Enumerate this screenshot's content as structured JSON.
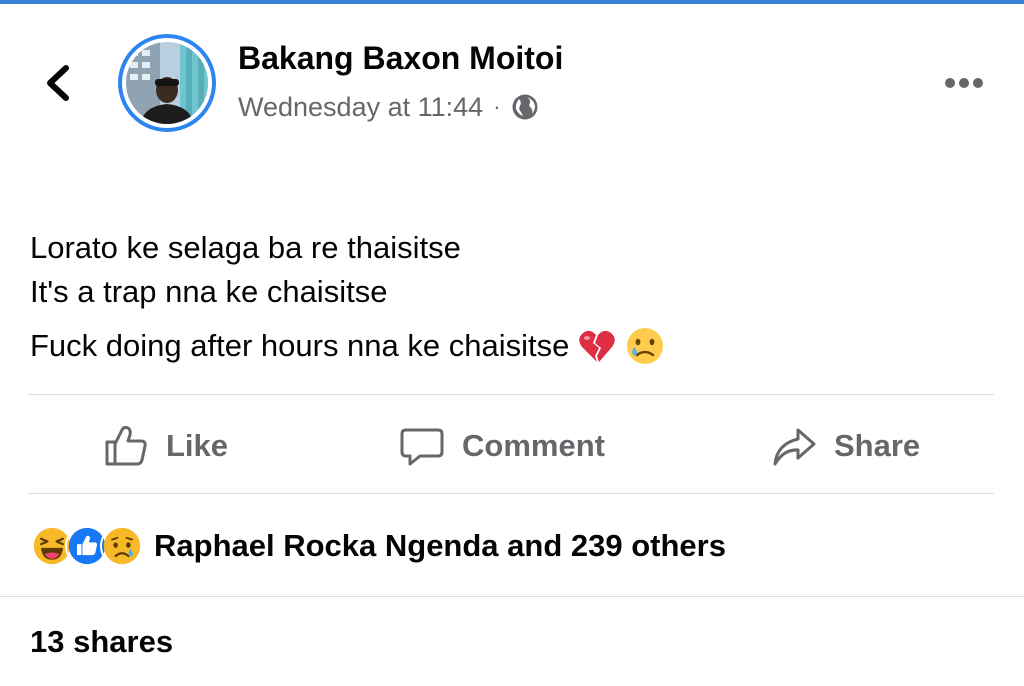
{
  "post": {
    "author_name": "Bakang Baxon Moitoi",
    "timestamp": "Wednesday at 11:44",
    "separator": "·",
    "privacy_icon": "globe-icon",
    "lines": [
      "Lorato ke selaga ba re thaisitse",
      "It's a trap nna ke chaisitse",
      "Fuck doing after hours nna ke chaisitse"
    ],
    "trailing_emojis": [
      "broken-heart-emoji",
      "crying-face-emoji"
    ]
  },
  "actions": {
    "like_label": "Like",
    "comment_label": "Comment",
    "share_label": "Share"
  },
  "reactions": {
    "icons": [
      "laughing-reaction-icon",
      "like-reaction-icon",
      "sad-reaction-icon"
    ],
    "summary": "Raphael Rocka Ngenda and 239 others"
  },
  "shares": {
    "count_text": "13 shares"
  },
  "colors": {
    "accent": "#2d86f0",
    "like_blue": "#1877f2",
    "secondary_text": "#65676b",
    "divider": "#dadde1",
    "reaction_yellow": "#f7b928"
  }
}
